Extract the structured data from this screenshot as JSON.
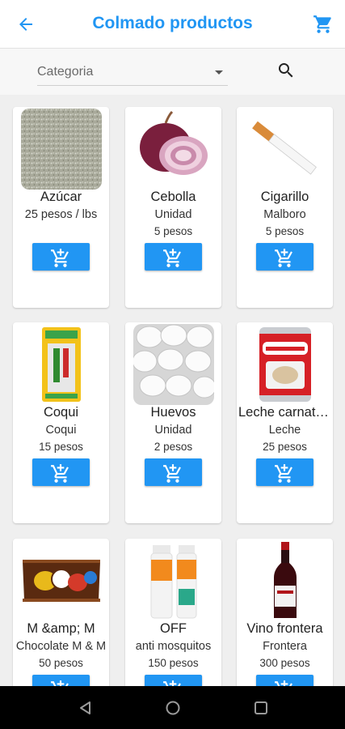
{
  "app": {
    "title": "Colmado productos",
    "accent_color": "#2196f3",
    "back_icon": "arrow-back-icon",
    "cart_icon": "shopping-cart-icon"
  },
  "filter": {
    "category_value": "Categoria",
    "search_icon": "search-icon"
  },
  "products": [
    {
      "name": "Azúcar",
      "sub": "25 pesos / lbs",
      "price": "",
      "image": "sugar"
    },
    {
      "name": "Cebolla",
      "sub": "Unidad",
      "price": "5 pesos",
      "image": "onion"
    },
    {
      "name": "Cigarillo",
      "sub": "Malboro",
      "price": "5 pesos",
      "image": "cigarette"
    },
    {
      "name": "Coqui",
      "sub": "Coqui",
      "price": "15 pesos",
      "image": "coqui-pack"
    },
    {
      "name": "Huevos",
      "sub": "Unidad",
      "price": "2 pesos",
      "image": "eggs"
    },
    {
      "name": "Leche carnation",
      "sub": "Leche",
      "price": "25 pesos",
      "image": "milk-can"
    },
    {
      "name": "M &amp; M",
      "sub": "Chocolate M & M",
      "price": "50 pesos",
      "image": "mm-bag"
    },
    {
      "name": "OFF",
      "sub": "anti mosquitos",
      "price": "150 pesos",
      "image": "off-spray"
    },
    {
      "name": "Vino frontera",
      "sub": "Frontera",
      "price": "300 pesos",
      "image": "wine-bottle"
    }
  ],
  "add_button_icon": "add-shopping-cart-icon",
  "system_nav": {
    "back": "nav-back-icon",
    "home": "nav-home-icon",
    "recents": "nav-recents-icon"
  }
}
